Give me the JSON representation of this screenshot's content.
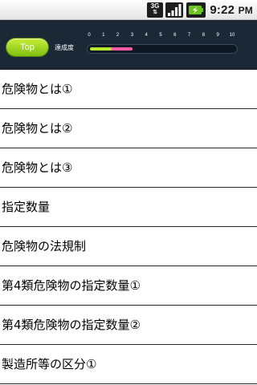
{
  "status_bar": {
    "network_label": "3G",
    "time": "9:22",
    "time_suffix": "PM"
  },
  "header": {
    "top_button_label": "Top",
    "progress_label": "達成度",
    "progress_ticks": [
      "0",
      "1",
      "2",
      "3",
      "4",
      "5",
      "6",
      "7",
      "8",
      "9",
      "10"
    ],
    "progress_value": 3,
    "progress_max": 10,
    "colors": {
      "background": "#1b2836",
      "button_green": "#9fd624",
      "progress_green": "#b6e82e",
      "progress_pink": "#ff5aa8"
    }
  },
  "list": {
    "items": [
      {
        "label": "危険物とは①"
      },
      {
        "label": "危険物とは②"
      },
      {
        "label": "危険物とは③"
      },
      {
        "label": "指定数量"
      },
      {
        "label": "危険物の法規制"
      },
      {
        "label": "第4類危険物の指定数量①"
      },
      {
        "label": "第4類危険物の指定数量②"
      },
      {
        "label": "製造所等の区分①"
      }
    ]
  }
}
